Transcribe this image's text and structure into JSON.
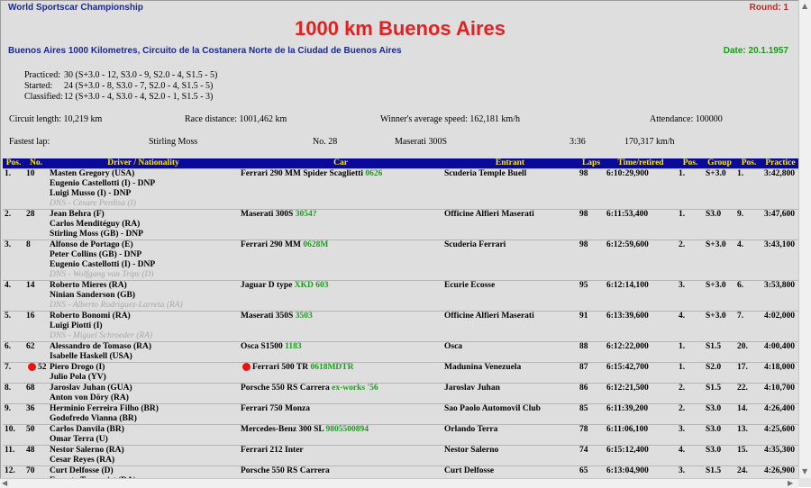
{
  "header": {
    "championship": "World Sportscar Championship",
    "round": "Round: 1",
    "title": "1000 km Buenos Aires",
    "subtitle": "Buenos Aires 1000 Kilometres, Circuito de la Costanera Norte de la Ciudad de Buenos Aires",
    "date": "Date: 20.1.1957"
  },
  "stats": {
    "practiced_label": "Practiced:",
    "practiced_value": "30 (S+3.0 - 12, S3.0 - 9, S2.0 - 4, S1.5 - 5)",
    "started_label": "Started:",
    "started_value": "24 (S+3.0 - 8, S3.0 - 7, S2.0 - 4, S1.5 - 5)",
    "classified_label": "Classified:",
    "classified_value": "12 (S+3.0 - 4, S3.0 - 4, S2.0 - 1, S1.5 - 3)"
  },
  "info": {
    "circuit_length": "Circuit length: 10,219 km",
    "race_distance": "Race distance: 1001,462 km",
    "winner_speed": "Winner's average speed: 162,181 km/h",
    "attendance": "Attendance: 100000",
    "fastest_label": "Fastest lap:",
    "fastest_driver": "Stirling Moss",
    "fastest_no": "No. 28",
    "fastest_car": "Maserati 300S",
    "fastest_time": "3:36",
    "fastest_speed": "170,317 km/h"
  },
  "table": {
    "headers": [
      "Pos.",
      "No.",
      "Driver / Nationality",
      "Car",
      "Entrant",
      "Laps",
      "Time/retired",
      "Pos.",
      "Group",
      "Pos.",
      "Practice"
    ],
    "rows": [
      {
        "pos": "1.",
        "no": "10",
        "drivers": [
          "Masten Gregory (USA)",
          "Eugenio Castellotti (I) - DNP",
          "Luigi Musso (I) - DNP"
        ],
        "dns": "DNS - Cesare Perdisa (I)",
        "car": "Ferrari 290 MM Spider Scaglietti",
        "chassis": "0626",
        "entrant": "Scuderia Temple Buell",
        "laps": "98",
        "time": "6:10:29,900",
        "cpos": "1.",
        "group": "S+3.0",
        "gpos": "1.",
        "practice": "3:42,800"
      },
      {
        "pos": "2.",
        "no": "28",
        "drivers": [
          "Jean Behra (F)",
          "Carlos Menditéguy (RA)",
          "Stirling Moss (GB) - DNP"
        ],
        "dns": "",
        "car": "Maserati 300S",
        "chassis": "3054?",
        "entrant": "Officine Alfieri Maserati",
        "laps": "98",
        "time": "6:11:53,400",
        "cpos": "1.",
        "group": "S3.0",
        "gpos": "9.",
        "practice": "3:47,600"
      },
      {
        "pos": "3.",
        "no": "8",
        "drivers": [
          "Alfonso de Portago (E)",
          "Peter Collins (GB) - DNP",
          "Eugenio Castellotti (I) - DNP"
        ],
        "dns": "DNS - Wolfgang von Trips (D)",
        "car": "Ferrari 290 MM",
        "chassis": "0628M",
        "entrant": "Scuderia Ferrari",
        "laps": "98",
        "time": "6:12:59,600",
        "cpos": "2.",
        "group": "S+3.0",
        "gpos": "4.",
        "practice": "3:43,100"
      },
      {
        "pos": "4.",
        "no": "14",
        "drivers": [
          "Roberto Mieres (RA)",
          "Ninian Sanderson (GB)"
        ],
        "dns": "DNS - Alberto Rodriguez-Larreta (RA)",
        "car": "Jaguar D type",
        "chassis": "XKD 603",
        "entrant": "Ecurie Ecosse",
        "laps": "95",
        "time": "6:12:14,100",
        "cpos": "3.",
        "group": "S+3.0",
        "gpos": "6.",
        "practice": "3:53,800"
      },
      {
        "pos": "5.",
        "no": "16",
        "drivers": [
          "Roberto Bonomi (RA)",
          "Luigi Piotti (I)"
        ],
        "dns": "DNS - Miguel Schroeder (RA)",
        "car": "Maserati 350S",
        "chassis": "3503",
        "entrant": "Officine Alfieri Maserati",
        "laps": "91",
        "time": "6:13:39,600",
        "cpos": "4.",
        "group": "S+3.0",
        "gpos": "7.",
        "practice": "4:02,000"
      },
      {
        "pos": "6.",
        "no": "62",
        "drivers": [
          "Alessandro de Tomaso (RA)",
          "Isabelle Haskell (USA)"
        ],
        "dns": "",
        "car": "Osca S1500",
        "chassis": "1183",
        "entrant": "Osca",
        "laps": "88",
        "time": "6:12:22,000",
        "cpos": "1.",
        "group": "S1.5",
        "gpos": "20.",
        "practice": "4:00,400"
      },
      {
        "pos": "7.",
        "no": "52",
        "dot": true,
        "drivers": [
          "Piero Drogo (I)",
          "Julio Pola (YV)"
        ],
        "dns": "",
        "car": "Ferrari 500 TR",
        "chassis": "0618MDTR",
        "entrant": "Madunina Venezuela",
        "laps": "87",
        "time": "6:15:42,700",
        "cpos": "1.",
        "group": "S2.0",
        "gpos": "17.",
        "practice": "4:18,000"
      },
      {
        "pos": "8.",
        "no": "68",
        "drivers": [
          "Jaroslav Juhan (GUA)",
          "Anton von Döry (RA)"
        ],
        "dns": "",
        "car": "Porsche 550 RS Carrera",
        "chassis": "ex-works '56",
        "entrant": "Jaroslav Juhan",
        "laps": "86",
        "time": "6:12:21,500",
        "cpos": "2.",
        "group": "S1.5",
        "gpos": "22.",
        "practice": "4:10,700"
      },
      {
        "pos": "9.",
        "no": "36",
        "drivers": [
          "Herminio Ferreira Filho (BR)",
          "Godofredo Vianna (BR)"
        ],
        "dns": "",
        "car": "Ferrari 750 Monza",
        "chassis": "",
        "entrant": "Sao Paolo Automovil Club",
        "laps": "85",
        "time": "6:11:39,200",
        "cpos": "2.",
        "group": "S3.0",
        "gpos": "14.",
        "practice": "4:26,400"
      },
      {
        "pos": "10.",
        "no": "50",
        "drivers": [
          "Carlos Danvila (BR)",
          "Omar Terra (U)"
        ],
        "dns": "",
        "car": "Mercedes-Benz 300 SL",
        "chassis": "9805500894",
        "entrant": "Orlando Terra",
        "laps": "78",
        "time": "6:11:06,100",
        "cpos": "3.",
        "group": "S3.0",
        "gpos": "13.",
        "practice": "4:25,600"
      },
      {
        "pos": "11.",
        "no": "48",
        "drivers": [
          "Nestor Salerno (RA)",
          "Cesar Reyes (RA)"
        ],
        "dns": "",
        "car": "Ferrari 212 Inter",
        "chassis": "",
        "entrant": "Nestor Salerno",
        "laps": "74",
        "time": "6:15:12,400",
        "cpos": "4.",
        "group": "S3.0",
        "gpos": "15.",
        "practice": "4:35,300"
      },
      {
        "pos": "12.",
        "no": "70",
        "drivers": [
          "Curt Delfosse (D)",
          "Ernesto Tornquist (RA)"
        ],
        "dns": "",
        "car": "Porsche 550 RS Carrera",
        "chassis": "",
        "entrant": "Curt Delfosse",
        "laps": "65",
        "time": "6:13:04,900",
        "cpos": "3.",
        "group": "S1.5",
        "gpos": "24.",
        "practice": "4:26,900"
      }
    ]
  },
  "colors": {
    "title": "#e41f1f",
    "header_bg": "#0a0a99",
    "header_text": "#ffea00",
    "chassis": "#1f9a1f",
    "date": "#1a9a1a",
    "page_bg": "#dedede"
  },
  "icons": {
    "scroll_up": "up-arrow-icon",
    "scroll_down": "down-arrow-icon",
    "scroll_left": "left-arrow-icon",
    "scroll_right": "right-arrow-icon"
  }
}
